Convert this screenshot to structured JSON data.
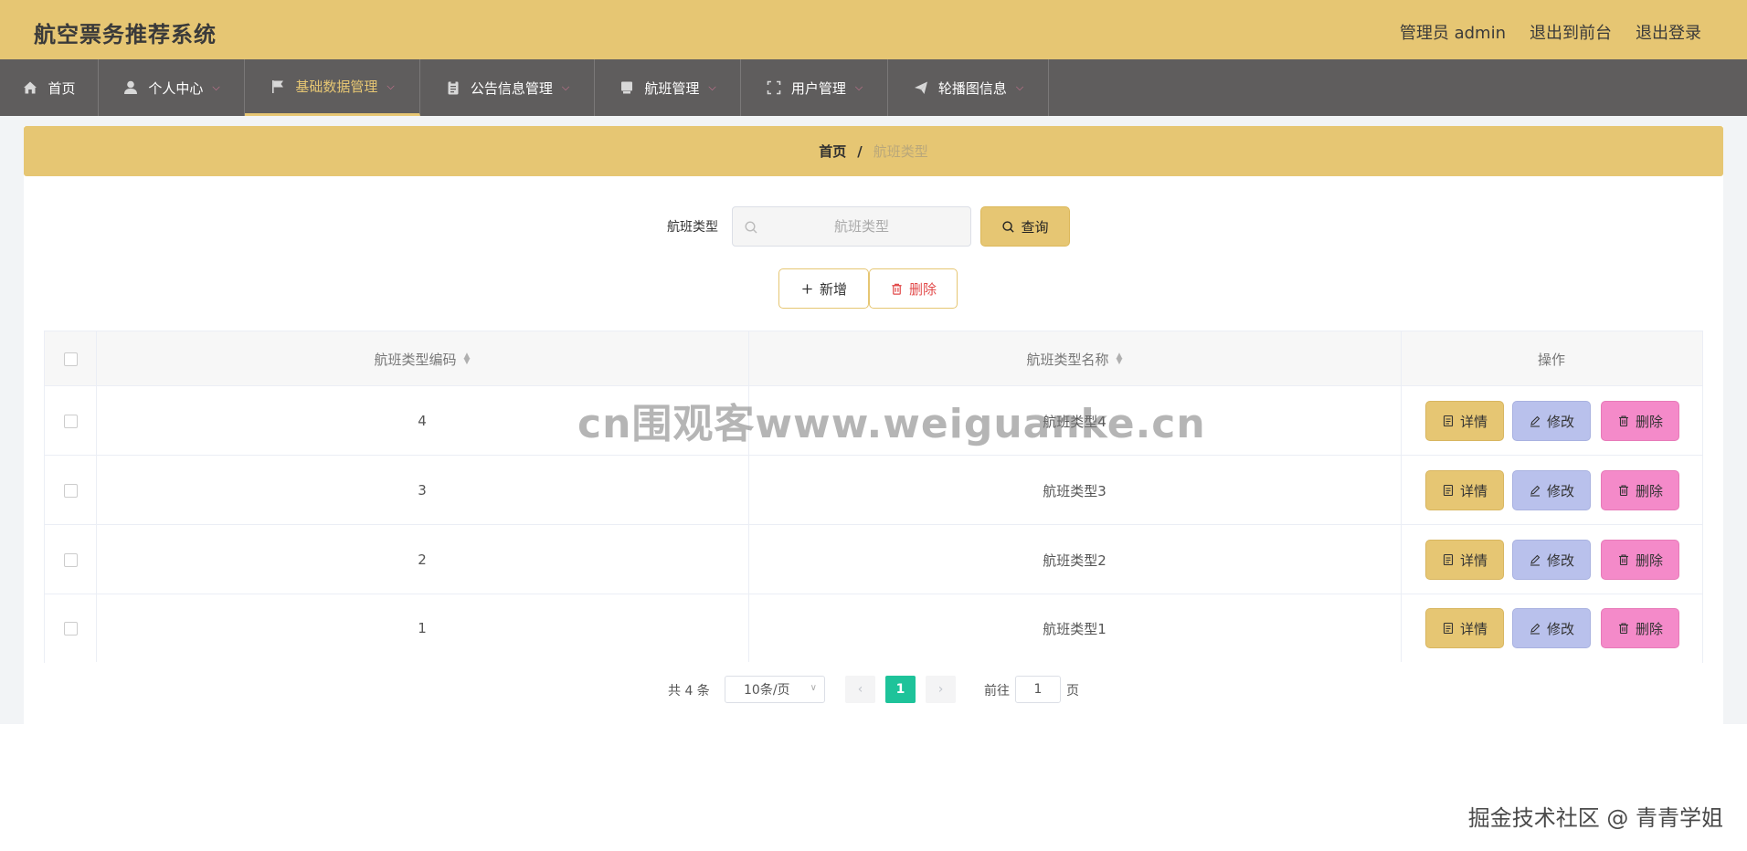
{
  "header": {
    "title": "航空票务推荐系统",
    "admin": "管理员 admin",
    "back_front": "退出到前台",
    "logout": "退出登录"
  },
  "nav": {
    "items": [
      {
        "label": "首页",
        "icon": "home-icon"
      },
      {
        "label": "个人中心",
        "icon": "user-icon"
      },
      {
        "label": "基础数据管理",
        "icon": "flag-icon",
        "active": true
      },
      {
        "label": "公告信息管理",
        "icon": "clipboard-icon"
      },
      {
        "label": "航班管理",
        "icon": "monitor-icon"
      },
      {
        "label": "用户管理",
        "icon": "fullscreen-icon"
      },
      {
        "label": "轮播图信息",
        "icon": "send-icon"
      }
    ],
    "active_color": "#e6c673"
  },
  "breadcrumb": {
    "home": "首页",
    "sep": "/",
    "current": "航班类型"
  },
  "search": {
    "label": "航班类型",
    "placeholder": "航班类型",
    "button": "查询"
  },
  "actions": {
    "add": "新增",
    "delete": "删除"
  },
  "table": {
    "columns": [
      "航班类型编码",
      "航班类型名称",
      "操作"
    ],
    "rows": [
      {
        "code": "4",
        "name": "航班类型4"
      },
      {
        "code": "3",
        "name": "航班类型3"
      },
      {
        "code": "2",
        "name": "航班类型2"
      },
      {
        "code": "1",
        "name": "航班类型1"
      }
    ],
    "op_labels": {
      "detail": "详情",
      "edit": "修改",
      "delete": "删除"
    }
  },
  "pagination": {
    "total": "共 4 条",
    "page_size": "10条/页",
    "current_page": "1",
    "goto_label": "前往",
    "goto_value": "1",
    "page_unit": "页"
  },
  "watermarks": {
    "center": "cn围观客www.weiguanke.cn",
    "bottom_right": "掘金技术社区 @ 青青学姐"
  },
  "colors": {
    "header_bg": "#e6c673",
    "nav_bg": "#5f5d5d",
    "detail_btn": "#e6c673",
    "edit_btn": "#b9c1ec",
    "delete_btn": "#f48ac9",
    "page_active": "#1ec39a"
  }
}
